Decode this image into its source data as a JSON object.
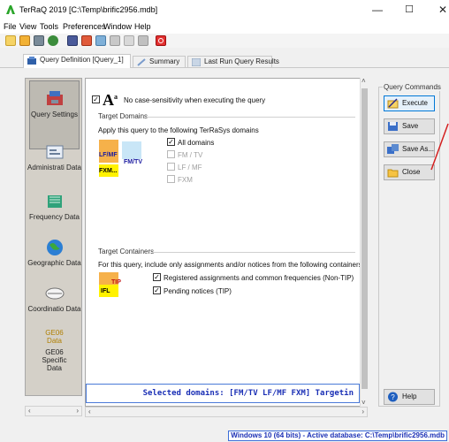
{
  "window": {
    "title": "TerRaQ 2019 [C:\\Temp\\brific2956.mdb]",
    "minimize": "—",
    "maximize": "☐",
    "close": "✕"
  },
  "menu": [
    "File",
    "View",
    "Tools",
    "Preferences",
    "Window",
    "Help"
  ],
  "toolbar_icons": [
    "open-icon",
    "edit-icon",
    "database-icon",
    "globe-icon",
    "users-icon",
    "map-icon",
    "grid-icon",
    "filter-icon",
    "query-icon",
    "terminate-icon"
  ],
  "tabs": [
    {
      "label": "Query Definition [Query_1]",
      "icon": "query-definition-icon"
    },
    {
      "label": "Summary",
      "icon": "summary-icon"
    },
    {
      "label": "Last Run Query Results",
      "icon": "results-icon"
    }
  ],
  "sidebar": {
    "items": [
      {
        "label": "Query Settings",
        "icon": "query-settings-icon"
      },
      {
        "label": "Administrati Data",
        "icon": "administrative-data-icon"
      },
      {
        "label": "Frequency Data",
        "icon": "frequency-data-icon"
      },
      {
        "label": "Geographic Data",
        "icon": "geographic-data-icon"
      },
      {
        "label": "Coordinatio Data",
        "icon": "coordination-data-icon"
      },
      {
        "label": "GE06 Data",
        "icon": ""
      },
      {
        "label": "GE06 Specific Data",
        "icon": ""
      }
    ]
  },
  "main": {
    "case_option": "No case-sensitivity when executing the query",
    "target_domains": {
      "title": "Target Domains",
      "description": "Apply this query to the following TerRaSys domains",
      "badges": [
        "LF/MF",
        "FM/TV",
        "FXM..."
      ],
      "options": [
        {
          "label": "All domains",
          "checked": true,
          "enabled": true
        },
        {
          "label": "FM / TV",
          "checked": false,
          "enabled": false
        },
        {
          "label": "LF / MF",
          "checked": false,
          "enabled": false
        },
        {
          "label": "FXM",
          "checked": false,
          "enabled": false
        }
      ]
    },
    "target_containers": {
      "title": "Target Containers",
      "description": "For this query, include only assignments and/or notices from the following containers",
      "badges": [
        "TIP",
        "IFL"
      ],
      "options": [
        {
          "label": "Registered assignments and common frequencies (Non-TIP)",
          "checked": true
        },
        {
          "label": "Pending notices (TIP)",
          "checked": true
        }
      ]
    },
    "summary": "Selected domains: [FM/TV LF/MF FXM]  Targetin"
  },
  "commands": {
    "title": "Query Commands",
    "buttons": [
      {
        "label": "Execute",
        "icon": "execute-icon"
      },
      {
        "label": "Save",
        "icon": "save-icon"
      },
      {
        "label": "Save As...",
        "icon": "save-as-icon"
      },
      {
        "label": "Close",
        "icon": "close-folder-icon"
      }
    ],
    "help": "Help"
  },
  "status": "Windows 10 (64 bits) - Active database: C:\\Temp\\brific2956.mdb",
  "colors": {
    "accent": "#1a2fb5",
    "highlight_border": "#0078d7",
    "annotation": "#d42020",
    "sidebar_bg": "#d4d0c8"
  }
}
